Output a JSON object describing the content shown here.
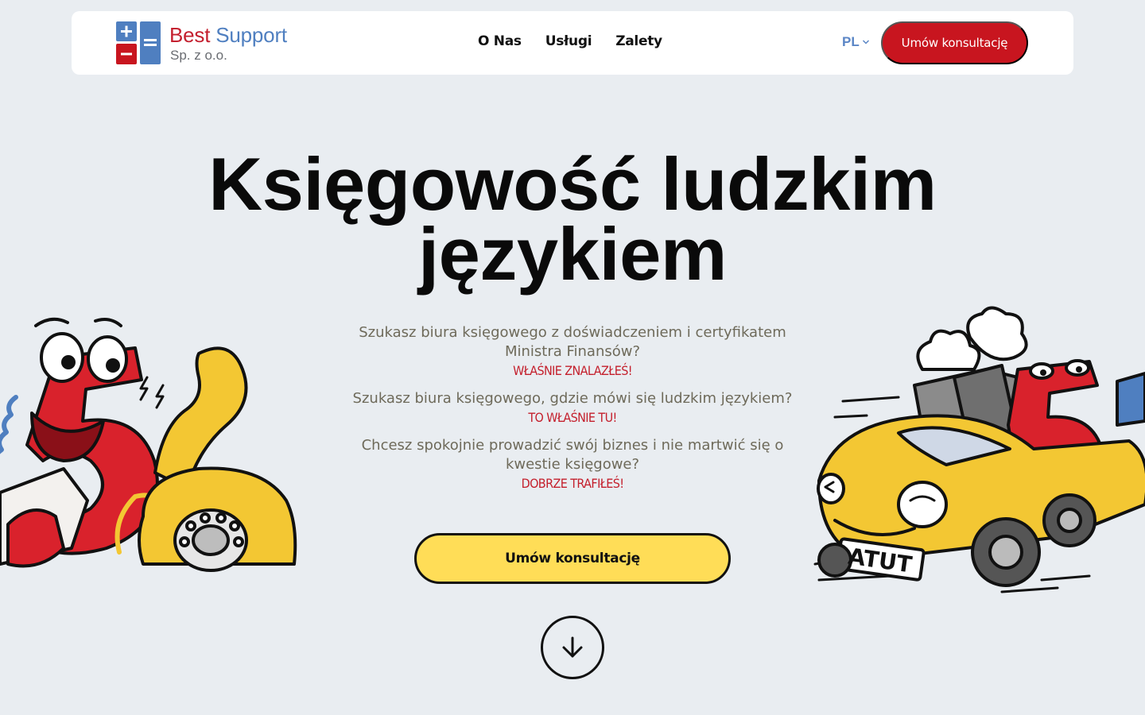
{
  "header": {
    "logo": {
      "title_part1": "Best",
      "title_part2": "Support",
      "subtitle": "Sp. z o.o."
    },
    "nav": [
      {
        "label": "O Nas"
      },
      {
        "label": "Usługi"
      },
      {
        "label": "Zalety"
      }
    ],
    "language": {
      "selected": "PL"
    },
    "cta_label": "Umów konsultację"
  },
  "hero": {
    "title_line1": "Księgowość ludzkim",
    "title_line2": "językiem",
    "questions": [
      {
        "text": "Szukasz biura księgowego z doświadczeniem i certyfikatem Ministra Finansów?",
        "answer": "WŁAŚNIE ZNALAZŁEŚ!"
      },
      {
        "text": "Szukasz biura księgowego, gdzie mówi się ludzkim językiem?",
        "answer": "TO WŁAŚNIE TU!"
      },
      {
        "text": "Chcesz spokojnie prowadzić swój biznes i nie martwić się o kwestie księgowe?",
        "answer": "DOBRZE TRAFIŁEŚ!"
      }
    ],
    "cta_label": "Umów konsultację",
    "car_plate": "ATUT"
  },
  "icons": {
    "logo_mark": "calculator-plus-minus-equals-icon",
    "lang_chevron": "chevron-down-icon",
    "scroll": "arrow-down-icon"
  },
  "colors": {
    "brand_red": "#c8151f",
    "brand_blue": "#4f7fc0",
    "cta_yellow": "#ffdd57",
    "background": "#e9edf1"
  }
}
